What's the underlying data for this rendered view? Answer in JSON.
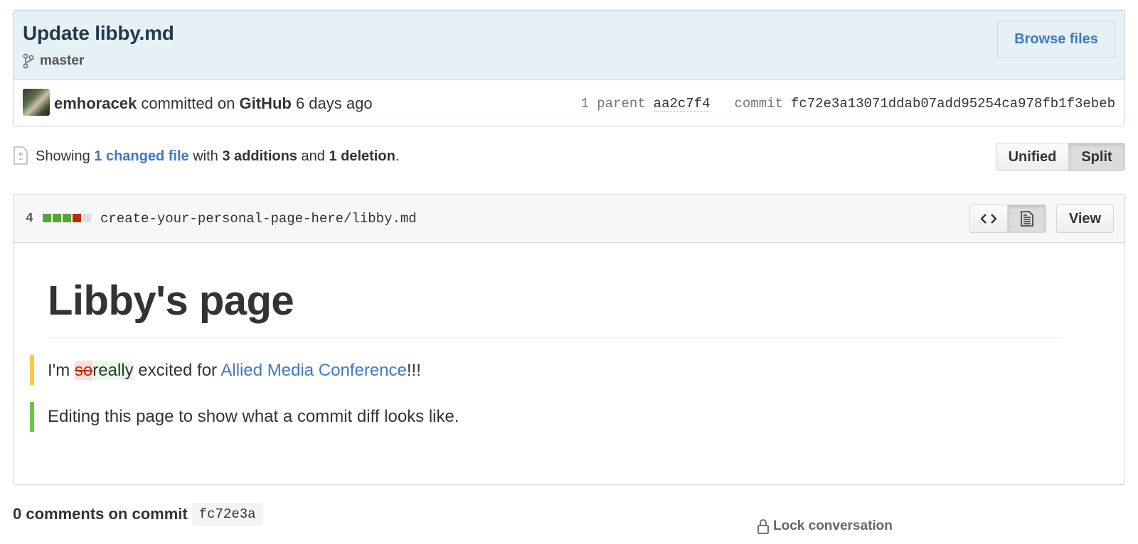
{
  "commit": {
    "title": "Update libby.md",
    "branch": "master",
    "browse_files": "Browse files",
    "author": "emhoracek",
    "committed_on": "committed on",
    "platform": "GitHub",
    "time_ago": "6 days ago",
    "parent_label": "1 parent",
    "parent_sha": "aa2c7f4",
    "commit_label": "commit",
    "sha": "fc72e3a13071ddab07add95254ca978fb1f3ebeb"
  },
  "toc": {
    "showing": "Showing",
    "changed_files": "1 changed file",
    "with": "with",
    "additions": "3 additions",
    "and": "and",
    "deletions": "1 deletion",
    "period": ".",
    "unified_label": "Unified",
    "split_label": "Split"
  },
  "file": {
    "change_count": "4",
    "diffstat": {
      "additions": 3,
      "deletions": 1,
      "neutral": 1
    },
    "colors": {
      "addition": "#55a532",
      "deletion": "#bd2c00",
      "neutral": "#dddddd"
    },
    "path": "create-your-personal-page-here/libby.md",
    "view_label": "View",
    "code_icon": "code-icon",
    "rich_diff_icon": "file-text-icon"
  },
  "rendered": {
    "heading": "Libby's page",
    "line1": {
      "prefix": "I'm ",
      "deleted": "so",
      "inserted": "really",
      "middle": " excited for ",
      "link": "Allied Media Conference",
      "suffix": "!!!"
    },
    "line2": "Editing this page to show what a commit diff looks like."
  },
  "comments": {
    "title": "0 comments on commit",
    "sha": "fc72e3a",
    "lock": "Lock conversation"
  }
}
